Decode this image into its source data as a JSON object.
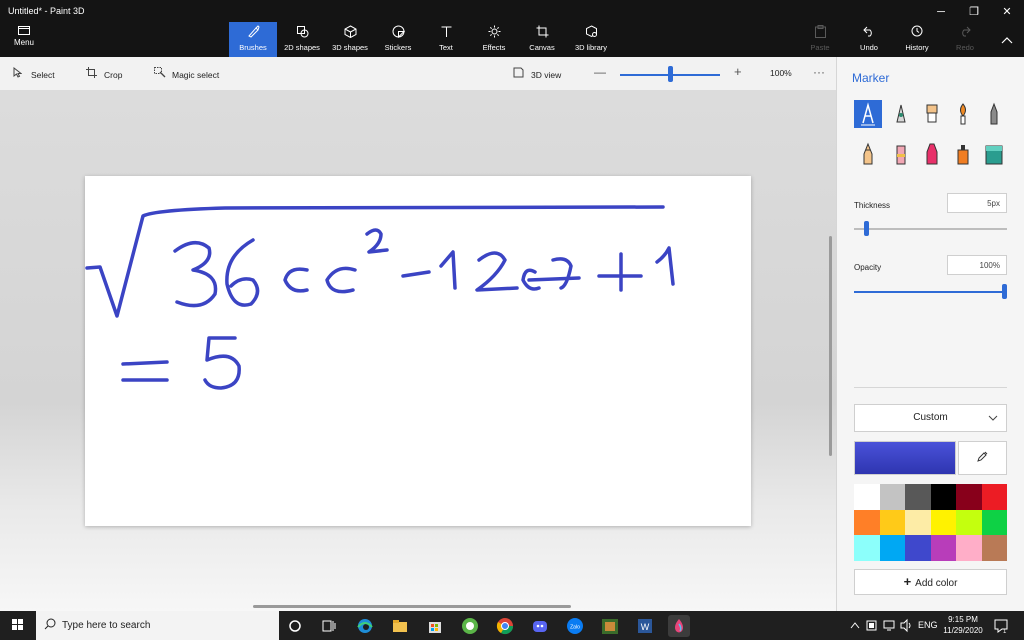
{
  "window": {
    "title": "Untitled* - Paint 3D",
    "minimize": "─",
    "maximize": "❐",
    "close": "✕"
  },
  "menu": {
    "label": "Menu"
  },
  "toolbar": {
    "tools": [
      {
        "label": "Brushes",
        "icon": "brush-icon"
      },
      {
        "label": "2D shapes",
        "icon": "2d-shapes-icon"
      },
      {
        "label": "3D shapes",
        "icon": "3d-shapes-icon"
      },
      {
        "label": "Stickers",
        "icon": "stickers-icon"
      },
      {
        "label": "Text",
        "icon": "text-icon"
      },
      {
        "label": "Effects",
        "icon": "effects-icon"
      },
      {
        "label": "Canvas",
        "icon": "canvas-icon"
      },
      {
        "label": "3D library",
        "icon": "3d-library-icon"
      }
    ],
    "active_tool": "Brushes",
    "right": [
      {
        "label": "Paste",
        "icon": "paste-icon",
        "enabled": false
      },
      {
        "label": "Undo",
        "icon": "undo-icon",
        "enabled": true
      },
      {
        "label": "History",
        "icon": "history-icon",
        "enabled": true
      },
      {
        "label": "Redo",
        "icon": "redo-icon",
        "enabled": false
      }
    ]
  },
  "subbar": {
    "select": "Select",
    "crop": "Crop",
    "magic_select": "Magic select",
    "view_3d": "3D view",
    "zoom": "100%",
    "zoom_fraction": 0.5
  },
  "canvas": {
    "drawing": {
      "equation_line1": "√36x² - 12x + 1",
      "equation_line2": "= 5",
      "ink_color": "#3b44c4"
    }
  },
  "panel": {
    "title": "Marker",
    "thickness_label": "Thickness",
    "thickness_value": "5px",
    "thickness_fraction": 0.05,
    "opacity_label": "Opacity",
    "opacity_value": "100%",
    "opacity_fraction": 1.0,
    "color_mode": "Custom",
    "current_color": "#3b44c4",
    "add_color": "Add color",
    "brushes": [
      "marker",
      "calligraphy-pen",
      "oil-brush",
      "watercolor",
      "pencil",
      "crayon",
      "pixel-pen",
      "spray-can",
      "eraser",
      "fill"
    ],
    "swatches": [
      "#ffffff",
      "#c3c3c3",
      "#585858",
      "#000000",
      "#88001b",
      "#ec1c24",
      "#ff7f27",
      "#ffca18",
      "#fdeca6",
      "#fff200",
      "#c4ff0e",
      "#0ed145",
      "#8cfffb",
      "#00a8f3",
      "#3f48cc",
      "#b83dba",
      "#ffaec8",
      "#b97a56"
    ]
  },
  "taskbar": {
    "search_placeholder": "Type here to search",
    "language": "ENG",
    "time": "9:15 PM",
    "date": "11/29/2020",
    "notifications": "1"
  }
}
